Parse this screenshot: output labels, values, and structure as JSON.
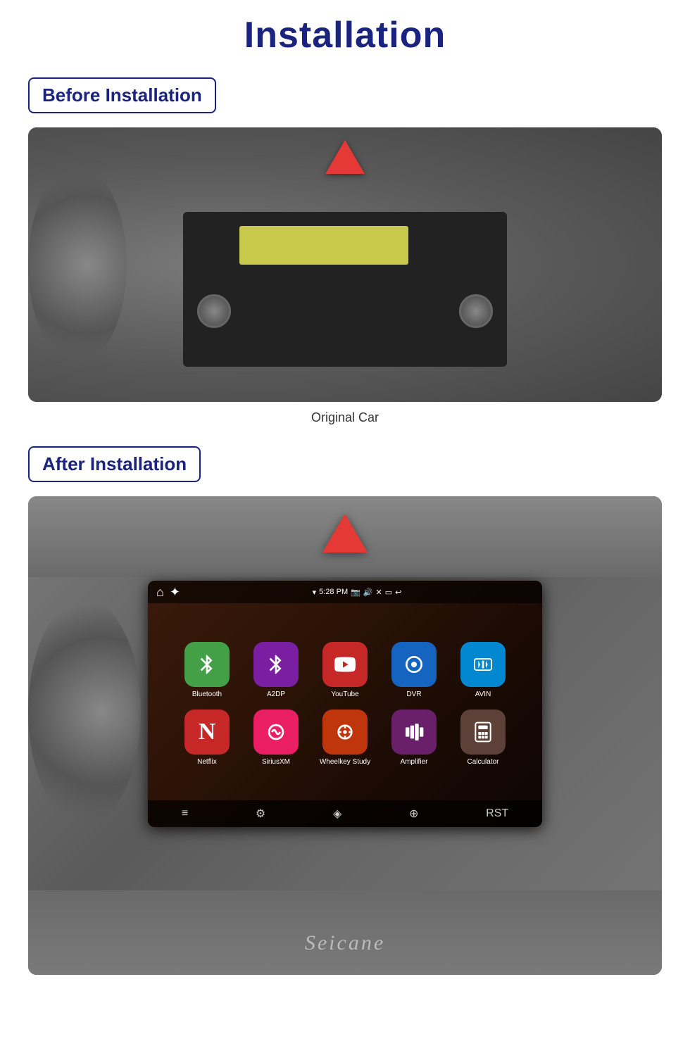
{
  "page": {
    "title": "Installation",
    "before_section": {
      "label": "Before Installation"
    },
    "after_section": {
      "label": "After Installation"
    },
    "caption": "Original Car",
    "apps": {
      "row1": [
        {
          "id": "bluetooth",
          "label": "Bluetooth",
          "color_class": "app-bluetooth",
          "icon": "⚡"
        },
        {
          "id": "a2dp",
          "label": "A2DP",
          "color_class": "app-a2dp",
          "icon": "✦"
        },
        {
          "id": "youtube",
          "label": "YouTube",
          "color_class": "app-youtube",
          "icon": "▶"
        },
        {
          "id": "dvr",
          "label": "DVR",
          "color_class": "app-dvr",
          "icon": "◎"
        },
        {
          "id": "avin",
          "label": "AVIN",
          "color_class": "app-avin",
          "icon": "⇅"
        }
      ],
      "row2": [
        {
          "id": "netflix",
          "label": "Netflix",
          "color_class": "app-netflix",
          "icon": "N"
        },
        {
          "id": "siriusxm",
          "label": "SiriusXM",
          "color_class": "app-siriusxm",
          "icon": "◉"
        },
        {
          "id": "wheelkey",
          "label": "Wheelkey Study",
          "color_class": "app-wheelkey",
          "icon": "⊕"
        },
        {
          "id": "amplifier",
          "label": "Amplifier",
          "color_class": "app-amplifier",
          "icon": "▦"
        },
        {
          "id": "calculator",
          "label": "Calculator",
          "color_class": "app-calculator",
          "icon": "⊞"
        }
      ]
    },
    "status_bar": {
      "time": "5:28 PM",
      "icons_right": [
        "📷",
        "🔊",
        "✕",
        "▭",
        "↩"
      ]
    },
    "brand": "Seicane"
  }
}
